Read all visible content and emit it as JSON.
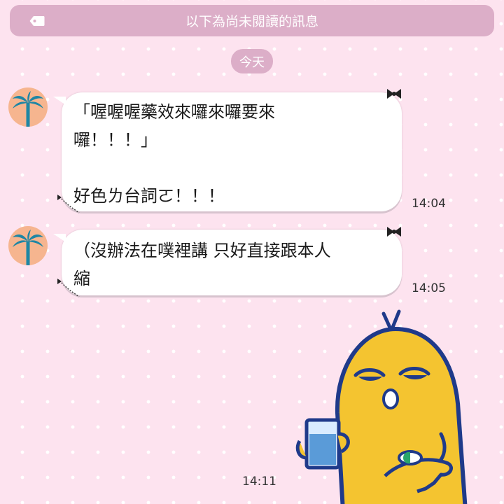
{
  "banner": {
    "text": "以下為尚未閱讀的訊息",
    "icon": "tag-icon"
  },
  "date_separator": "今天",
  "messages": [
    {
      "text": "「喔喔喔藥效來囉來囉要來\n囉！！！」\n\n好色ㄌ台詞ㄛ！！！",
      "time": "14:04",
      "avatar_icon": "palm-tree-icon"
    },
    {
      "text": "（沒辦法在噗裡講 只好直接跟本人\n縮",
      "time": "14:05",
      "avatar_icon": "palm-tree-icon"
    }
  ],
  "sticker": {
    "icon": "yellow-character-holding-water-glass-and-pill-sticker",
    "time": "14:11"
  },
  "colors": {
    "background": "#fde3ef",
    "banner": "#dcaec8",
    "avatar": "#f6b58f",
    "palm": "#1e86a4",
    "bubble": "#ffffff",
    "sticker_yellow": "#f4c430",
    "sticker_outline": "#1f3a8a"
  }
}
